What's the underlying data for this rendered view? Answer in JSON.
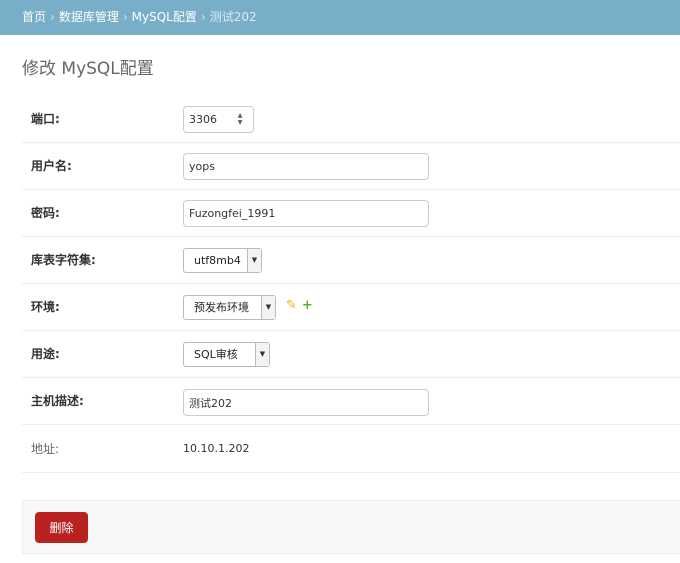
{
  "breadcrumbs": {
    "home": "首页",
    "db_admin": "数据库管理",
    "mysql_config": "MySQL配置",
    "current": "测试202",
    "separator": "›"
  },
  "page": {
    "title": "修改 MySQL配置"
  },
  "form": {
    "port": {
      "label": "端口:",
      "value": "3306"
    },
    "username": {
      "label": "用户名:",
      "value": "yops"
    },
    "password": {
      "label": "密码:",
      "value": "Fuzongfei_1991"
    },
    "charset": {
      "label": "库表字符集:",
      "value": "utf8mb4"
    },
    "environment": {
      "label": "环境:",
      "value": "预发布环境"
    },
    "purpose": {
      "label": "用途:",
      "value": "SQL审核"
    },
    "host_desc": {
      "label": "主机描述:",
      "value": "测试202"
    },
    "address": {
      "label": "地址:",
      "value": "10.10.1.202"
    }
  },
  "icons": {
    "spinner": "number-spinner-icon",
    "dropdown": "chevron-down-icon",
    "edit": "pencil-icon",
    "add": "plus-icon"
  },
  "colors": {
    "header_bg": "#79aec8",
    "delete_button": "#ba2121",
    "add_icon": "#5bb12f",
    "edit_icon": "#e5b600"
  },
  "actions": {
    "delete_label": "删除"
  }
}
